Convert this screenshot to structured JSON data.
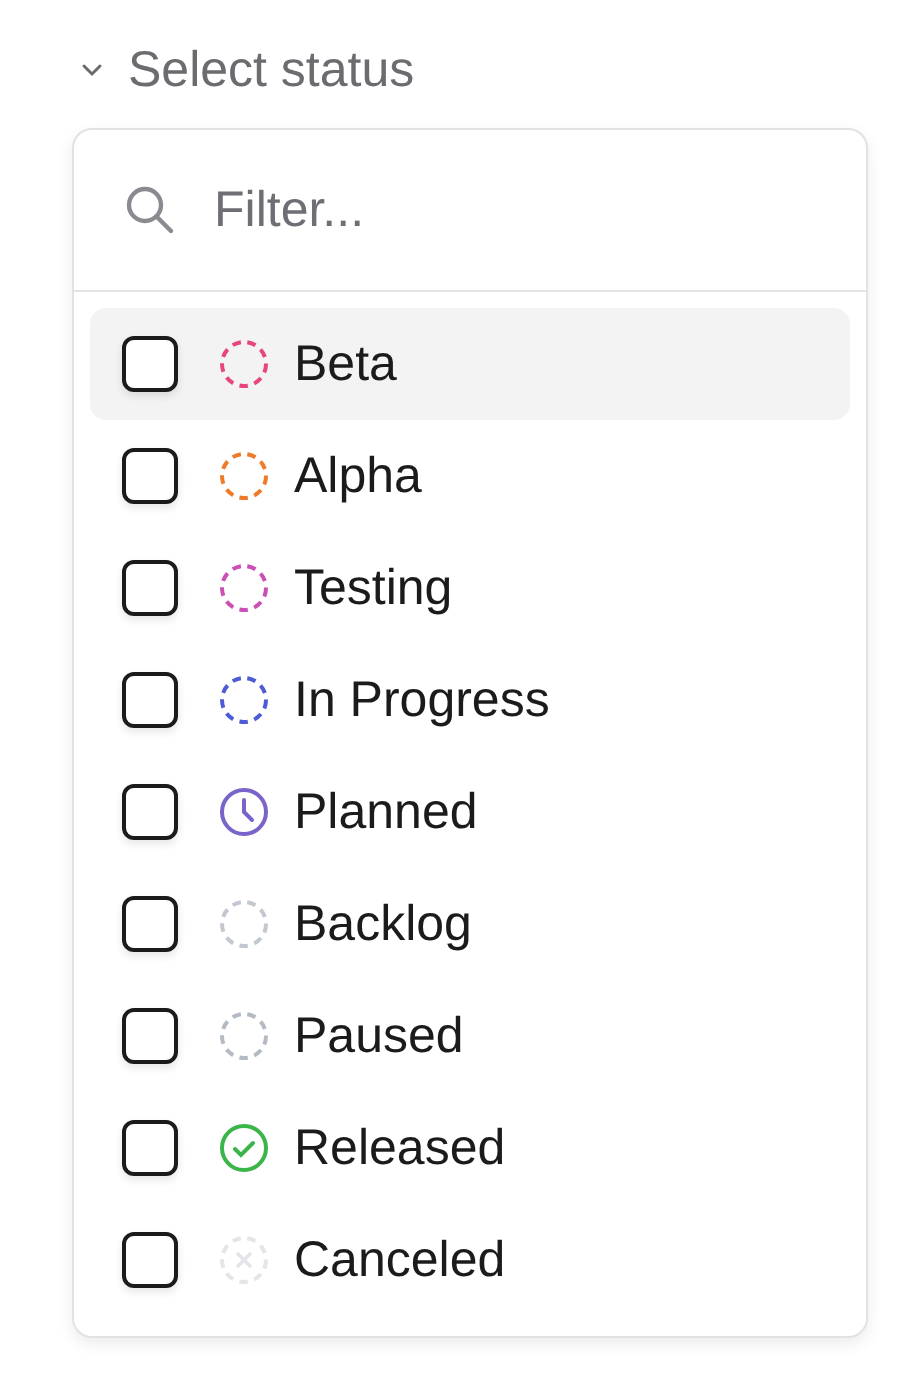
{
  "trigger": {
    "label": "Select status"
  },
  "filter": {
    "placeholder": "Filter..."
  },
  "options": [
    {
      "label": "Beta",
      "kind": "dashed",
      "color": "#e8457c",
      "checked": false,
      "selected": true
    },
    {
      "label": "Alpha",
      "kind": "dashed",
      "color": "#ee7a2a",
      "checked": false,
      "selected": false
    },
    {
      "label": "Testing",
      "kind": "dashed",
      "color": "#cc4fb6",
      "checked": false,
      "selected": false
    },
    {
      "label": "In Progress",
      "kind": "dashed",
      "color": "#4d5bd6",
      "checked": false,
      "selected": false
    },
    {
      "label": "Planned",
      "kind": "clock",
      "color": "#7a63c9",
      "checked": false,
      "selected": false
    },
    {
      "label": "Backlog",
      "kind": "dashed",
      "color": "#c3c8d0",
      "checked": false,
      "selected": false
    },
    {
      "label": "Paused",
      "kind": "dashed",
      "color": "#b4bac3",
      "checked": false,
      "selected": false
    },
    {
      "label": "Released",
      "kind": "check",
      "color": "#3bb54a",
      "checked": false,
      "selected": false
    },
    {
      "label": "Canceled",
      "kind": "cross",
      "color": "#e3e5e8",
      "checked": false,
      "selected": false
    }
  ]
}
